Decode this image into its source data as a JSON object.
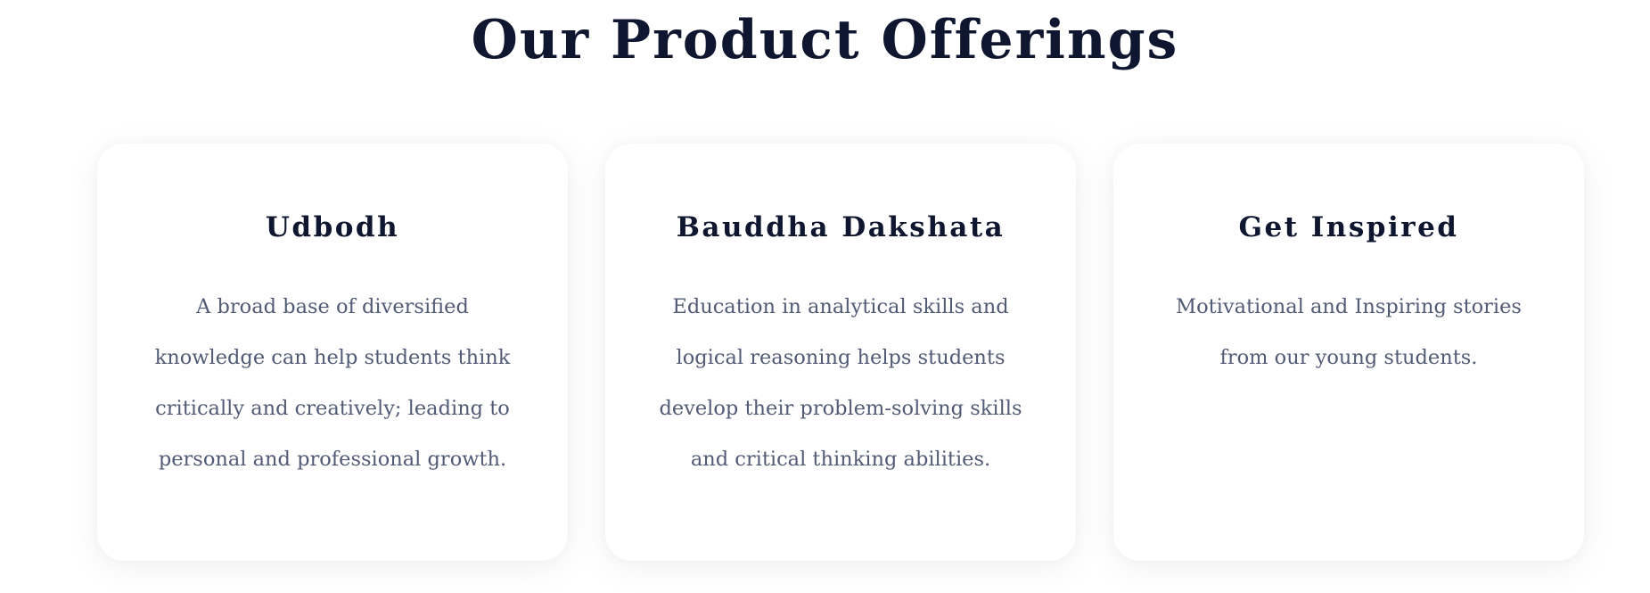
{
  "page": {
    "title": "Our Product Offerings"
  },
  "cards": [
    {
      "title": "Udbodh",
      "lines": [
        "A broad base of diversified",
        "knowledge can help students think",
        "critically and creatively; leading to",
        "personal and professional growth."
      ]
    },
    {
      "title": "Bauddha Dakshata",
      "lines": [
        "Education in analytical skills and",
        "logical reasoning helps students",
        "develop their problem-solving skills",
        "and critical thinking abilities."
      ]
    },
    {
      "title": "Get Inspired",
      "lines": [
        "Motivational and Inspiring stories",
        "from our young students."
      ]
    }
  ]
}
